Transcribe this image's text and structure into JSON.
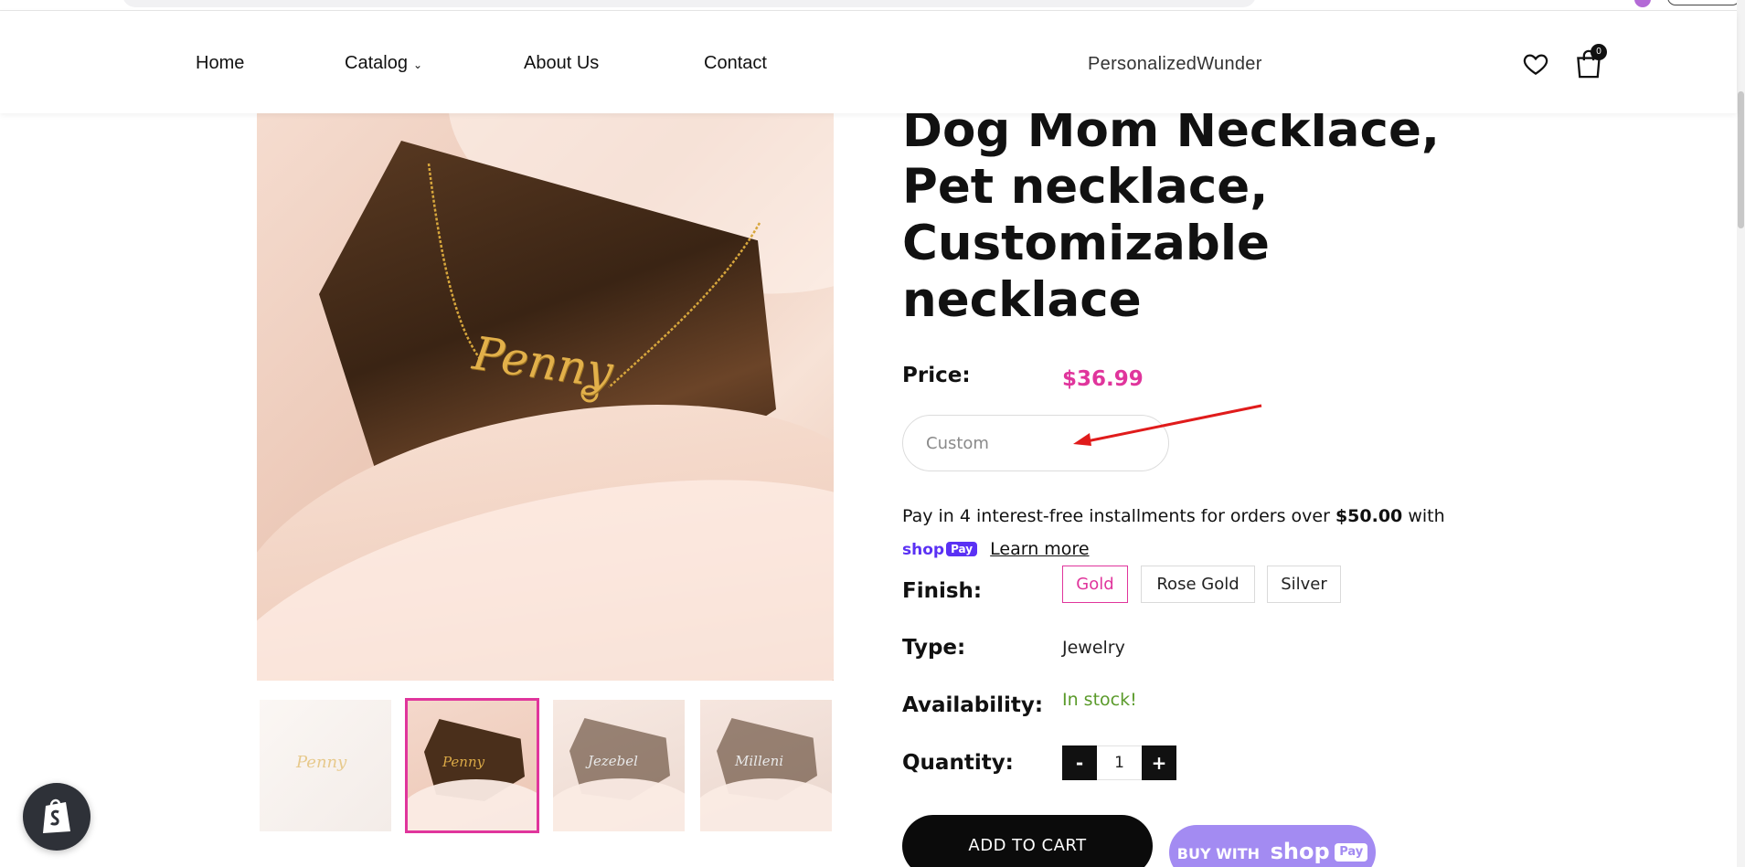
{
  "header": {
    "nav": {
      "home": "Home",
      "catalog": "Catalog",
      "about": "About Us",
      "contact": "Contact"
    },
    "brand": "PersonalizedWunder",
    "cart_count": "0"
  },
  "product": {
    "title": "Dog Mom Necklace, Pet necklace, Customizable necklace",
    "image_name_text": "Penny",
    "thumbnails": [
      {
        "name_text": "Penny"
      },
      {
        "name_text": "Penny"
      },
      {
        "name_text": "Jezebel"
      },
      {
        "name_text": "Milleni"
      }
    ],
    "selected_thumbnail": 1,
    "price_label": "Price:",
    "price": "$36.99",
    "custom_placeholder": "Custom",
    "installments": {
      "text_before": "Pay in 4 interest-free installments for orders over",
      "amount": "$50.00",
      "text_after": "with",
      "shop_logo": "shop",
      "pay_logo": "Pay",
      "learn_more": "Learn more"
    },
    "finish_label": "Finish:",
    "finish_options": [
      "Gold",
      "Rose Gold",
      "Silver"
    ],
    "finish_selected": "Gold",
    "type_label": "Type:",
    "type_value": "Jewelry",
    "availability_label": "Availability:",
    "availability_value": "In stock!",
    "quantity_label": "Quantity:",
    "quantity_minus": "-",
    "quantity_value": "1",
    "quantity_plus": "+",
    "add_to_cart": "ADD TO CART",
    "buy_with": "BUY WITH",
    "buy_shop": "shop",
    "buy_pay": "Pay"
  },
  "colors": {
    "accent_pink": "#e0359c",
    "in_stock_green": "#5a9a2a",
    "shop_pay_purple": "#5a31f4",
    "annotation_arrow": "#e01b1b"
  }
}
